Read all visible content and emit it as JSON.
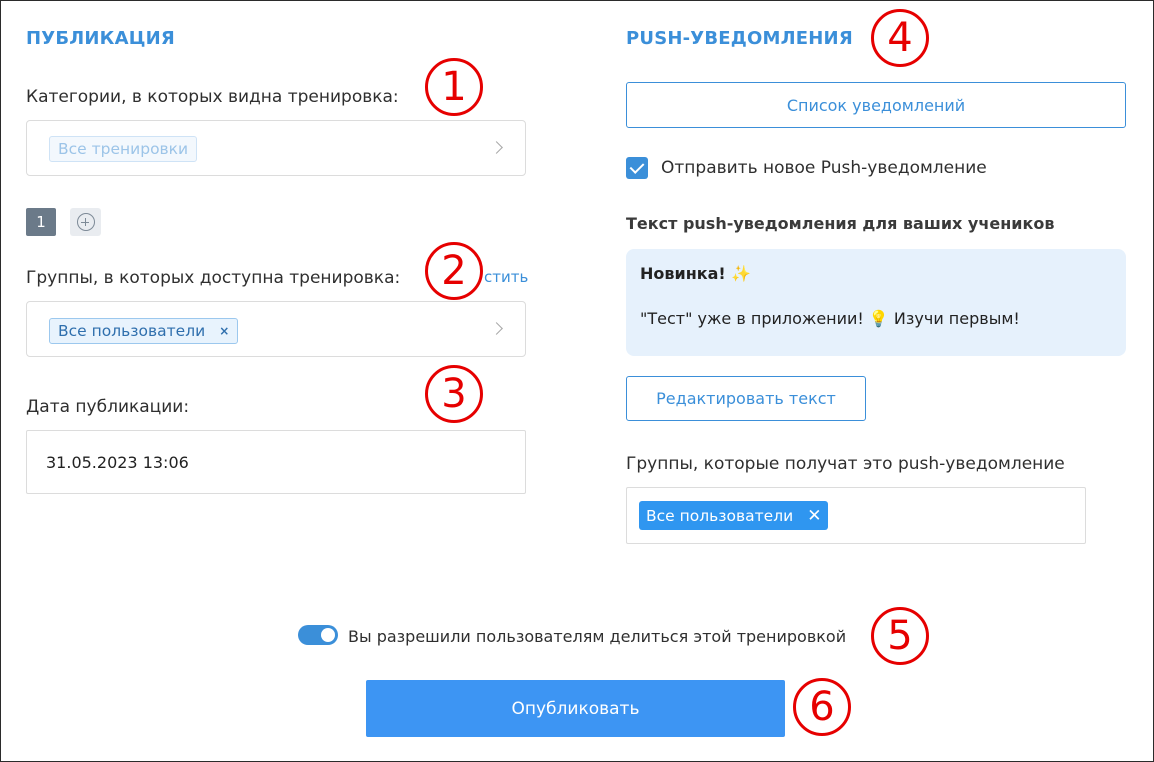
{
  "publication": {
    "title": "ПУБЛИКАЦИЯ",
    "categories_label": "Категории, в которых видна тренировка:",
    "categories_chip": "Все тренировки",
    "page_number": "1",
    "groups_label": "Группы, в которых доступна тренировка:",
    "groups_link_fragment": "стить",
    "groups_chip": "Все пользователи",
    "chip_remove": "×",
    "date_label": "Дата публикации:",
    "date_value": "31.05.2023 13:06"
  },
  "push": {
    "title": "PUSH-УВЕДОМЛЕНИЯ",
    "list_button": "Список уведомлений",
    "send_new_label": "Отправить новое Push-уведомление",
    "text_label": "Текст push-уведомления для ваших учеников",
    "preview_title": "Новинка! ✨",
    "preview_body": "\"Тест\" уже в приложении! 💡 Изучи первым!",
    "edit_button": "Редактировать текст",
    "groups_label": "Группы, которые получат это push-уведомление",
    "groups_chip": "Все пользователи",
    "chip_remove": "✕"
  },
  "footer": {
    "share_label": "Вы разрешили пользователям делиться этой тренировкой",
    "share_enabled": true,
    "publish_button": "Опубликовать"
  },
  "markers": [
    "1",
    "2",
    "3",
    "4",
    "5",
    "6"
  ],
  "colors": {
    "accent": "#3b8fd9",
    "publish": "#3d95f3",
    "marker": "#e60000",
    "preview_bg": "#e6f1fc"
  }
}
